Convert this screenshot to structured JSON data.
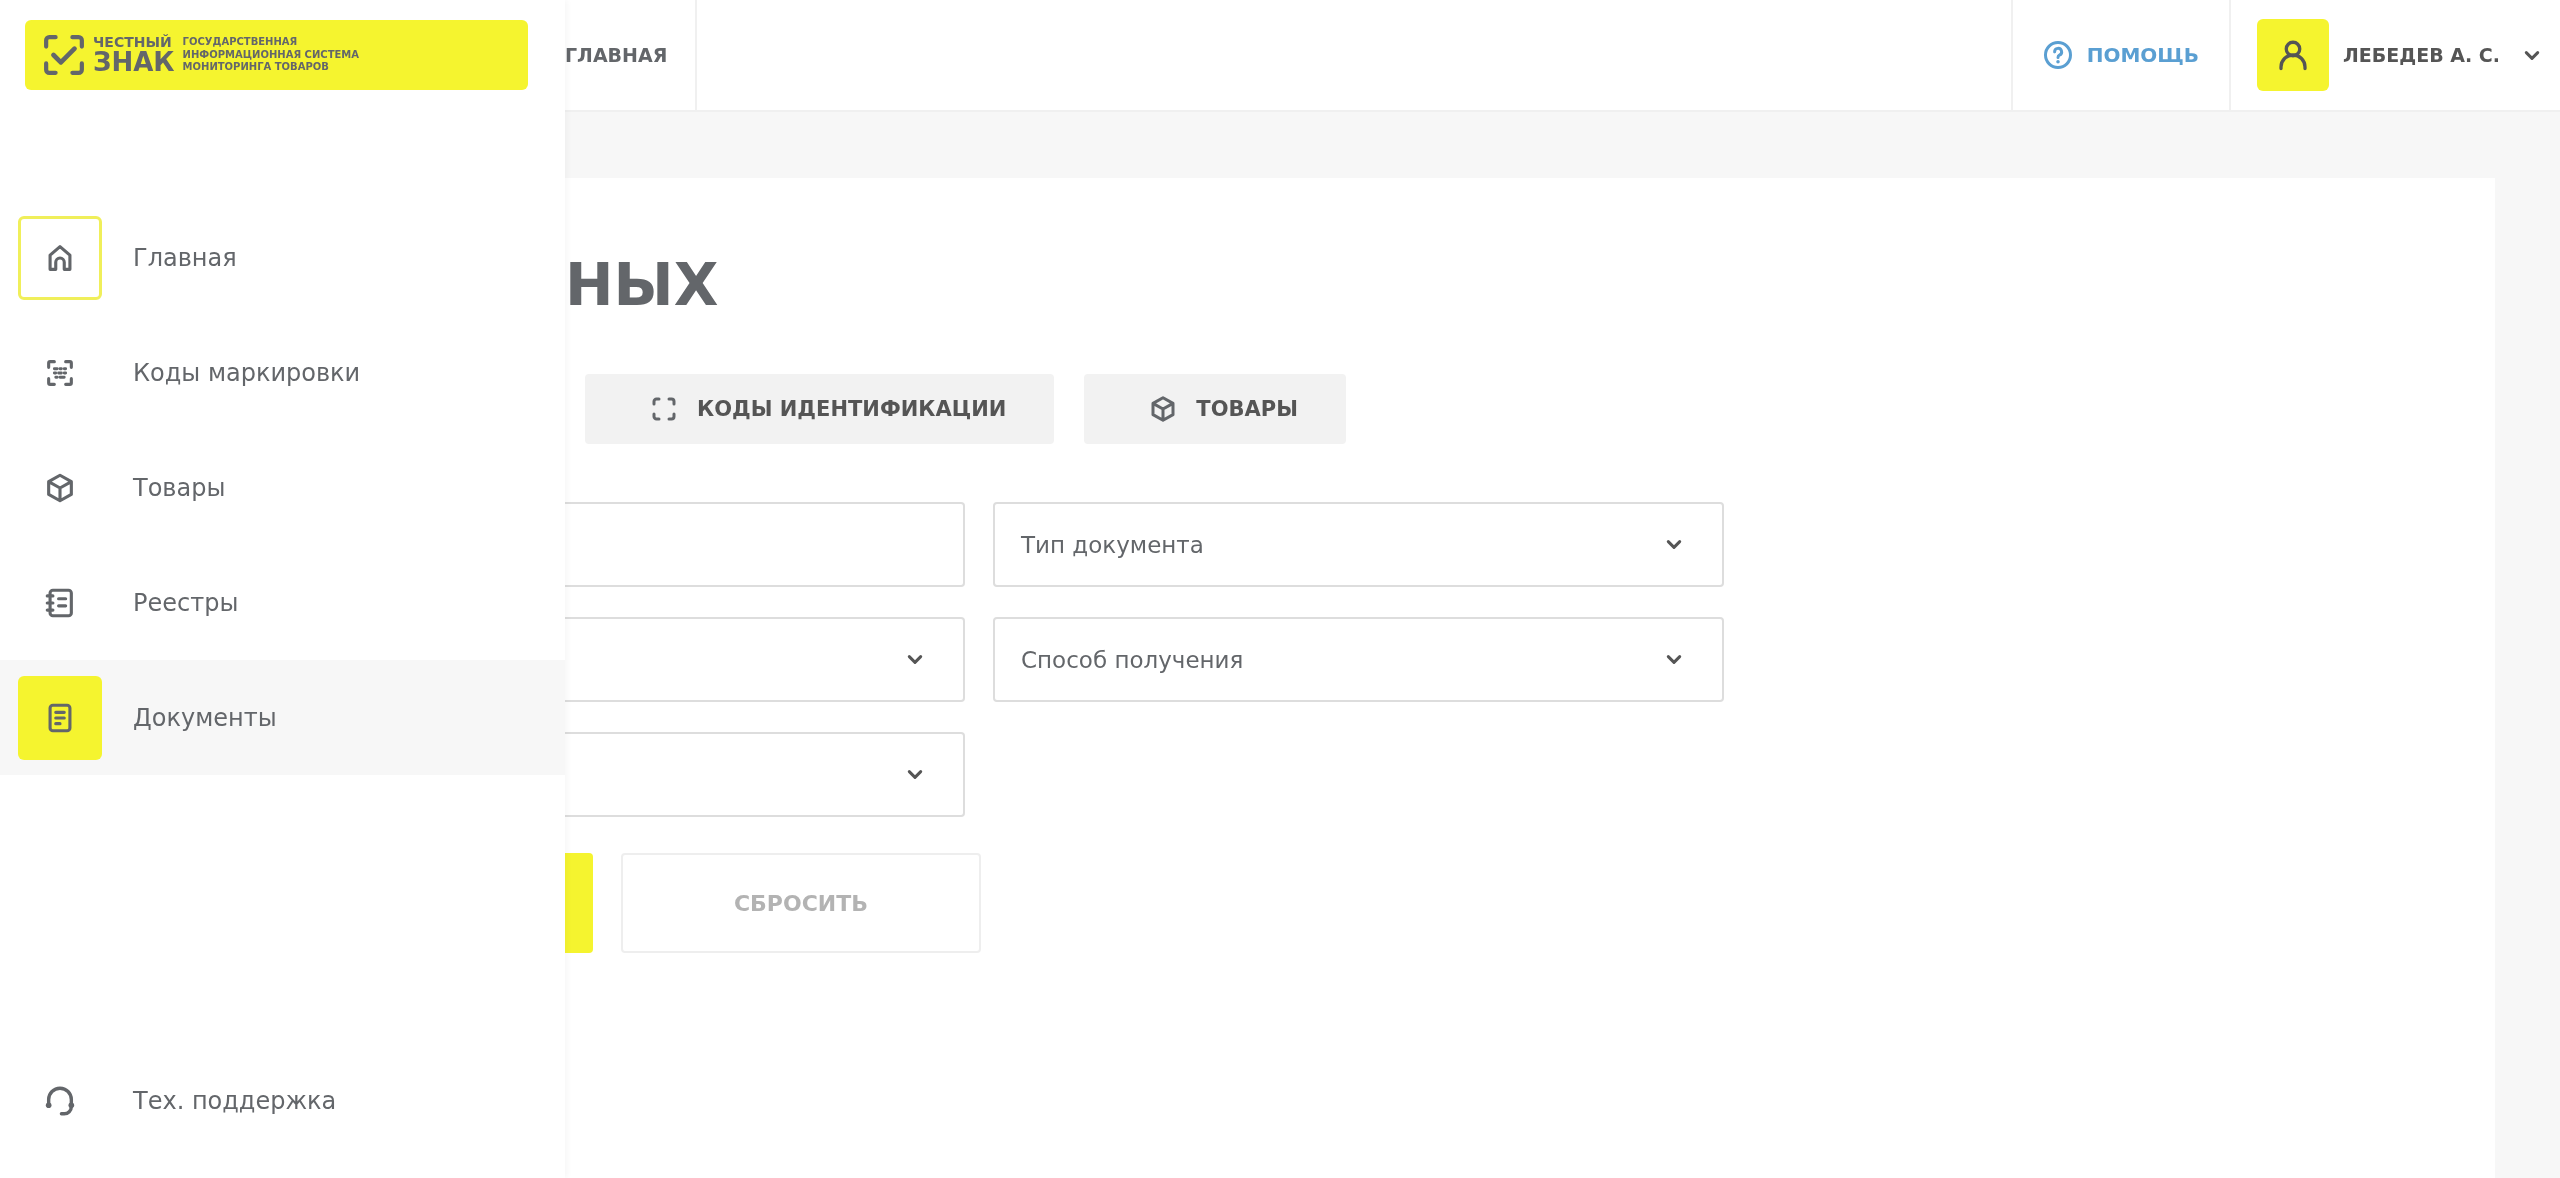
{
  "logo": {
    "name_top": "ЧЕСТНЫЙ",
    "name_bottom": "ЗНАК",
    "subtitle": [
      "ГОСУДАРСТВЕННАЯ",
      "ИНФОРМАЦИОННАЯ СИСТЕМА",
      "МОНИТОРИНГА ТОВАРОВ"
    ]
  },
  "sidebar": {
    "items": [
      {
        "label": "Главная",
        "selected": false,
        "focused": true
      },
      {
        "label": "Коды маркировки",
        "selected": false,
        "focused": false
      },
      {
        "label": "Товары",
        "selected": false,
        "focused": false
      },
      {
        "label": "Реестры",
        "selected": false,
        "focused": false
      },
      {
        "label": "Документы",
        "selected": true,
        "focused": false
      }
    ],
    "support": "Тех. поддержка"
  },
  "header": {
    "nav": "ГЛАВНАЯ",
    "help": "ПОМОЩЬ",
    "user": "ЛЕБЕДЕВ А. С."
  },
  "page": {
    "title": "НЫХ",
    "tabs": [
      {
        "label": "КОДЫ ИДЕНТИФИКАЦИИ"
      },
      {
        "label": "ТОВАРЫ"
      }
    ],
    "filters": {
      "column_1": [
        {
          "kind": "text"
        },
        {
          "kind": "select"
        },
        {
          "kind": "select"
        }
      ],
      "column_2": [
        {
          "kind": "select",
          "placeholder": "Тип документа"
        },
        {
          "kind": "select",
          "placeholder": "Способ получения"
        }
      ]
    },
    "actions": [
      {
        "kind": "primary"
      },
      {
        "kind": "secondary",
        "label": "СБРОСИТЬ"
      }
    ]
  }
}
